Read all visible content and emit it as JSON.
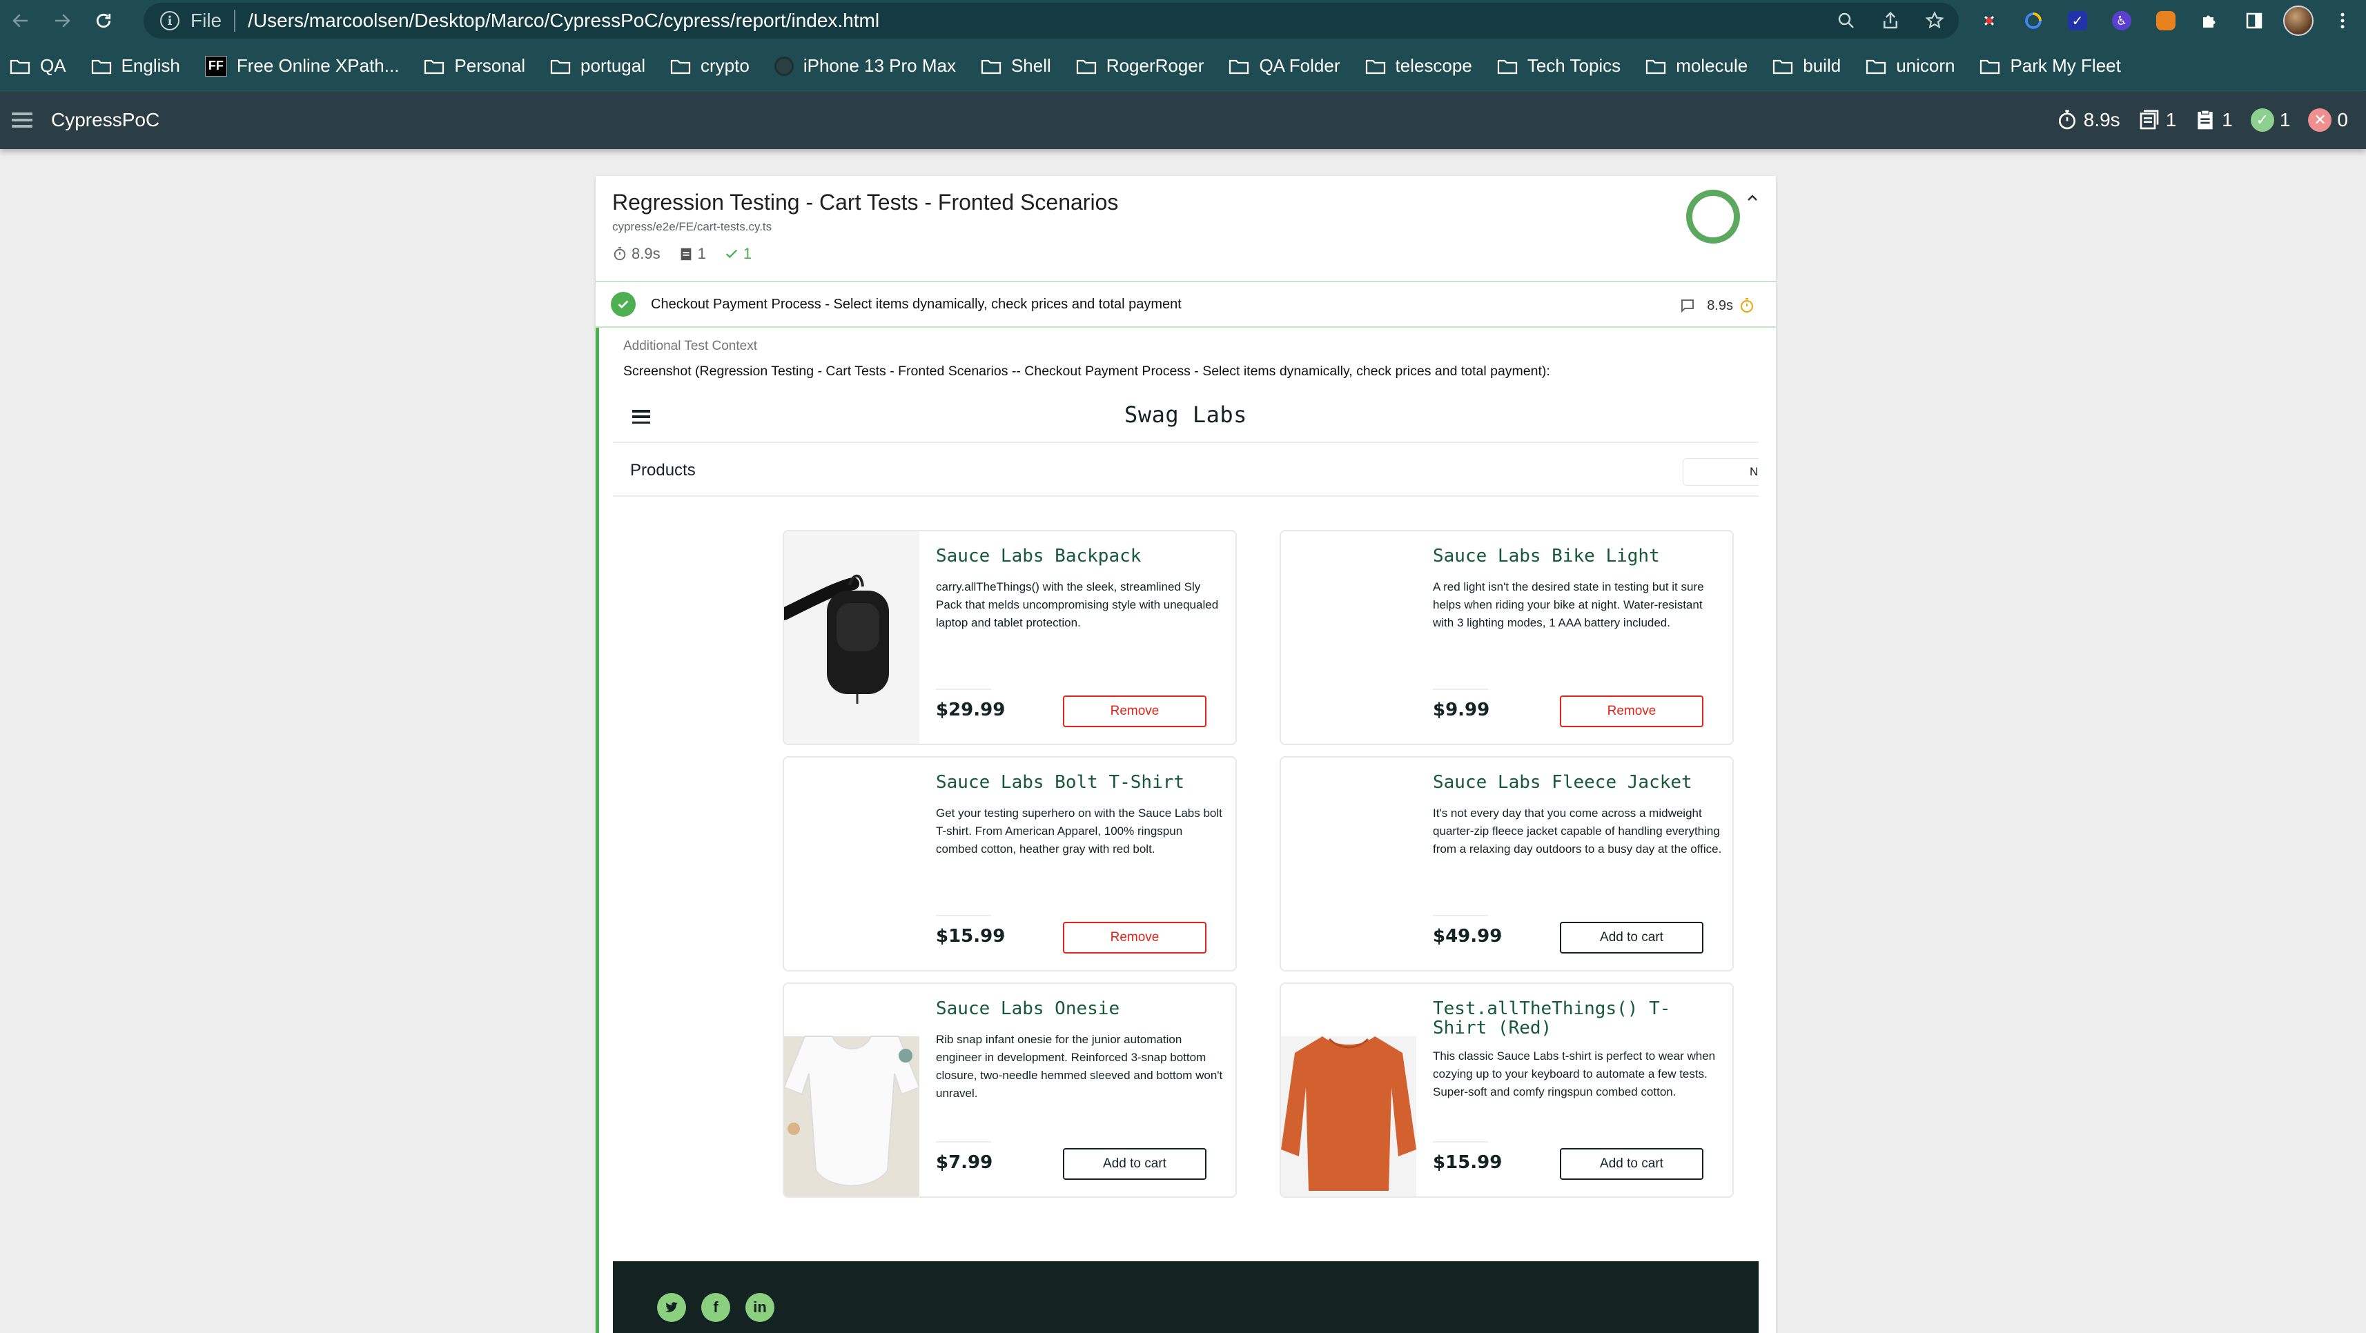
{
  "browser": {
    "url_scheme": "File",
    "url": "/Users/marcoolsen/Desktop/Marco/CypressPoC/cypress/report/index.html",
    "bookmarks": [
      {
        "label": "QA",
        "icon": "folder-icon"
      },
      {
        "label": "English",
        "icon": "folder-icon"
      },
      {
        "label": "Free Online XPath...",
        "icon": "ff-icon"
      },
      {
        "label": "Personal",
        "icon": "folder-icon"
      },
      {
        "label": "portugal",
        "icon": "folder-icon"
      },
      {
        "label": "crypto",
        "icon": "folder-icon"
      },
      {
        "label": "iPhone 13 Pro Max",
        "icon": "globe-icon"
      },
      {
        "label": "Shell",
        "icon": "folder-icon"
      },
      {
        "label": "RogerRoger",
        "icon": "folder-icon"
      },
      {
        "label": "QA Folder",
        "icon": "folder-icon"
      },
      {
        "label": "telescope",
        "icon": "folder-icon"
      },
      {
        "label": "Tech Topics",
        "icon": "folder-icon"
      },
      {
        "label": "molecule",
        "icon": "folder-icon"
      },
      {
        "label": "build",
        "icon": "folder-icon"
      },
      {
        "label": "unicorn",
        "icon": "folder-icon"
      },
      {
        "label": "Park My Fleet",
        "icon": "folder-icon"
      }
    ]
  },
  "app": {
    "title": "CypressPoC",
    "stats": {
      "duration": "8.9s",
      "suites": "1",
      "tests": "1",
      "passed": "1",
      "failed": "0"
    }
  },
  "suite": {
    "title": "Regression Testing - Cart Tests - Fronted Scenarios",
    "file": "cypress/e2e/FE/cart-tests.cy.ts",
    "duration": "8.9s",
    "tests": "1",
    "passed": "1",
    "test": {
      "title": "Checkout Payment Process - Select items dynamically, check prices and total payment",
      "duration": "8.9s"
    },
    "context_title": "Additional Test Context",
    "context_text": "Screenshot (Regression Testing - Cart Tests - Fronted Scenarios -- Checkout Payment Process - Select items dynamically, check prices and total payment):"
  },
  "swag": {
    "logo": "Swag Labs",
    "products_title": "Products",
    "sort_label": "Na",
    "items": [
      {
        "name": "Sauce Labs Backpack",
        "desc": "carry.allTheThings() with the sleek, streamlined Sly Pack that melds uncompromising style with unequaled laptop and tablet protection.",
        "price": "$29.99",
        "button": "Remove"
      },
      {
        "name": "Sauce Labs Bike Light",
        "desc": "A red light isn't the desired state in testing but it sure helps when riding your bike at night. Water-resistant with 3 lighting modes, 1 AAA battery included.",
        "price": "$9.99",
        "button": "Remove"
      },
      {
        "name": "Sauce Labs Bolt T-Shirt",
        "desc": "Get your testing superhero on with the Sauce Labs bolt T-shirt. From American Apparel, 100% ringspun combed cotton, heather gray with red bolt.",
        "price": "$15.99",
        "button": "Remove"
      },
      {
        "name": "Sauce Labs Fleece Jacket",
        "desc": "It's not every day that you come across a midweight quarter-zip fleece jacket capable of handling everything from a relaxing day outdoors to a busy day at the office.",
        "price": "$49.99",
        "button": "Add to cart"
      },
      {
        "name": "Sauce Labs Onesie",
        "desc": "Rib snap infant onesie for the junior automation engineer in development. Reinforced 3-snap bottom closure, two-needle hemmed sleeved and bottom won't unravel.",
        "price": "$7.99",
        "button": "Add to cart"
      },
      {
        "name": "Test.allTheThings() T-Shirt (Red)",
        "desc": "This classic Sauce Labs t-shirt is perfect to wear when cozying up to your keyboard to automate a few tests. Super-soft and comfy ringspun combed cotton.",
        "price": "$15.99",
        "button": "Add to cart"
      }
    ],
    "social": [
      "twitter-icon",
      "facebook-icon",
      "linkedin-icon"
    ]
  },
  "colors": {
    "chrome_bg": "#1f4b52",
    "appbar_bg": "#2c3e45",
    "pass_green": "#4caf50",
    "fail_red": "#e2231a",
    "swag_green": "#18583a"
  }
}
